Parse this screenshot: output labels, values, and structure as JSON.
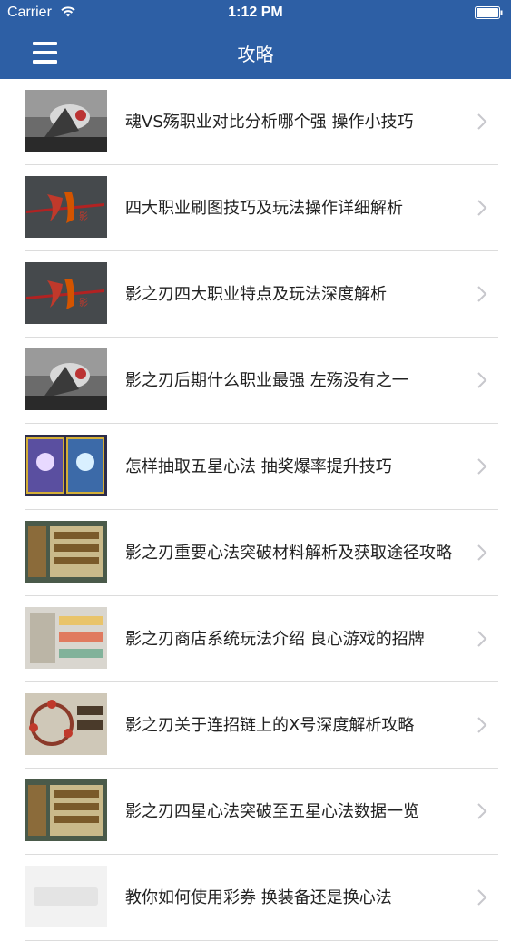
{
  "status_bar": {
    "carrier": "Carrier",
    "time": "1:12 PM",
    "icons": [
      "wifi-icon",
      "battery-icon"
    ]
  },
  "navbar": {
    "title": "攻略",
    "menu_icon": "hamburger-menu-icon"
  },
  "colors": {
    "header_bg": "#2d5fa5",
    "divider": "#dcdcdc",
    "chevron": "#c7c7cc",
    "text": "#222222"
  },
  "articles": [
    {
      "title": "魂VS殇职业对比分析哪个强 操作小技巧",
      "thumbnail": "game-character-art"
    },
    {
      "title": "四大职业刷图技巧及玩法操作详细解析",
      "thumbnail": "game-logo-red-sword"
    },
    {
      "title": "影之刃四大职业特点及玩法深度解析",
      "thumbnail": "game-logo-red-sword"
    },
    {
      "title": "影之刃后期什么职业最强 左殇没有之一",
      "thumbnail": "game-character-art"
    },
    {
      "title": "怎样抽取五星心法 抽奖爆率提升技巧",
      "thumbnail": "game-card-screenshot"
    },
    {
      "title": "影之刃重要心法突破材料解析及获取途径攻略",
      "thumbnail": "game-ui-screenshot"
    },
    {
      "title": "影之刃商店系统玩法介绍 良心游戏的招牌",
      "thumbnail": "game-shop-screenshot"
    },
    {
      "title": "影之刃关于连招链上的X号深度解析攻略",
      "thumbnail": "game-combo-screenshot"
    },
    {
      "title": "影之刃四星心法突破至五星心法数据一览",
      "thumbnail": "game-ui-screenshot"
    },
    {
      "title": "教你如何使用彩券 换装备还是换心法",
      "thumbnail": "placeholder-logo"
    }
  ]
}
